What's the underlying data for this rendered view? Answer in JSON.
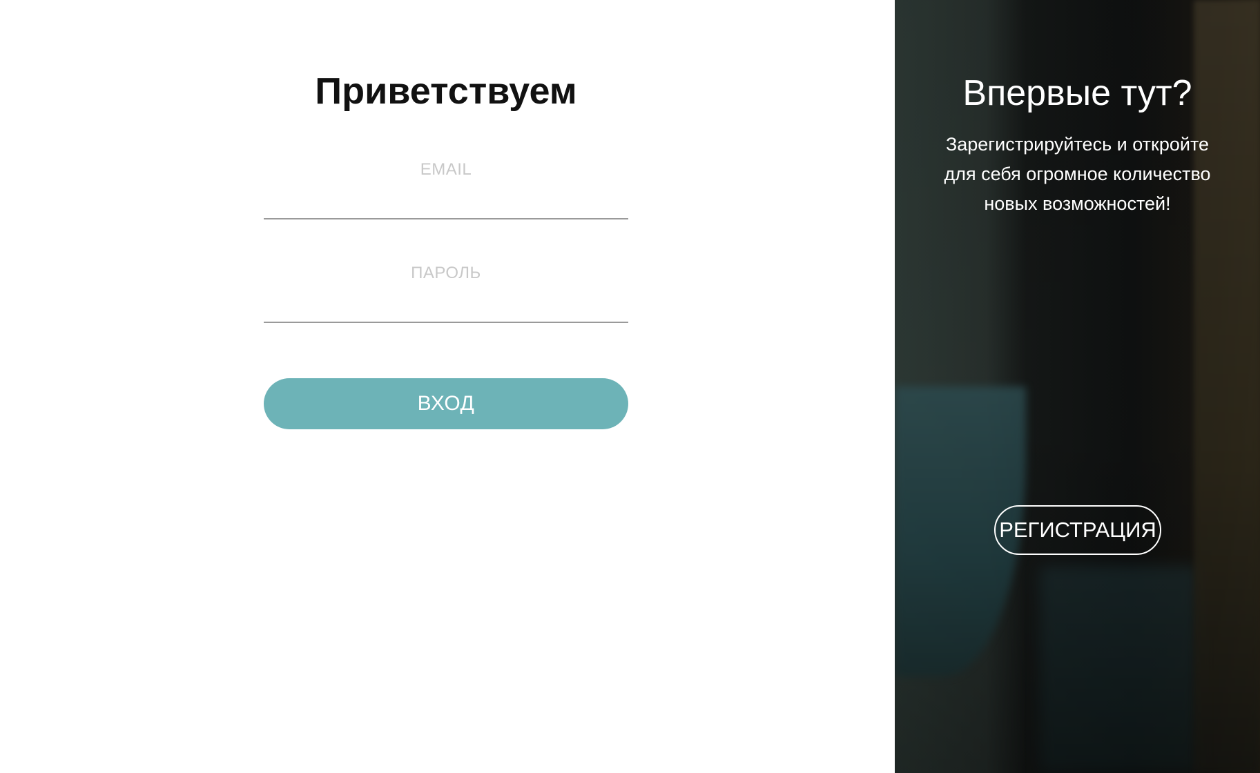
{
  "login": {
    "title": "Приветствуем",
    "email_placeholder": "EMAIL",
    "password_placeholder": "ПАРОЛЬ",
    "submit_label": "ВХОД"
  },
  "register": {
    "title": "Впервые тут?",
    "text": "Зарегистрируйтесь и откройте для себя огромное количество новых возможностей!",
    "button_label": "РЕГИСТРАЦИЯ"
  },
  "colors": {
    "accent": "#6db3b7",
    "title_text": "#111111",
    "placeholder": "#c8c8c8",
    "underline": "#9a9a9a"
  }
}
